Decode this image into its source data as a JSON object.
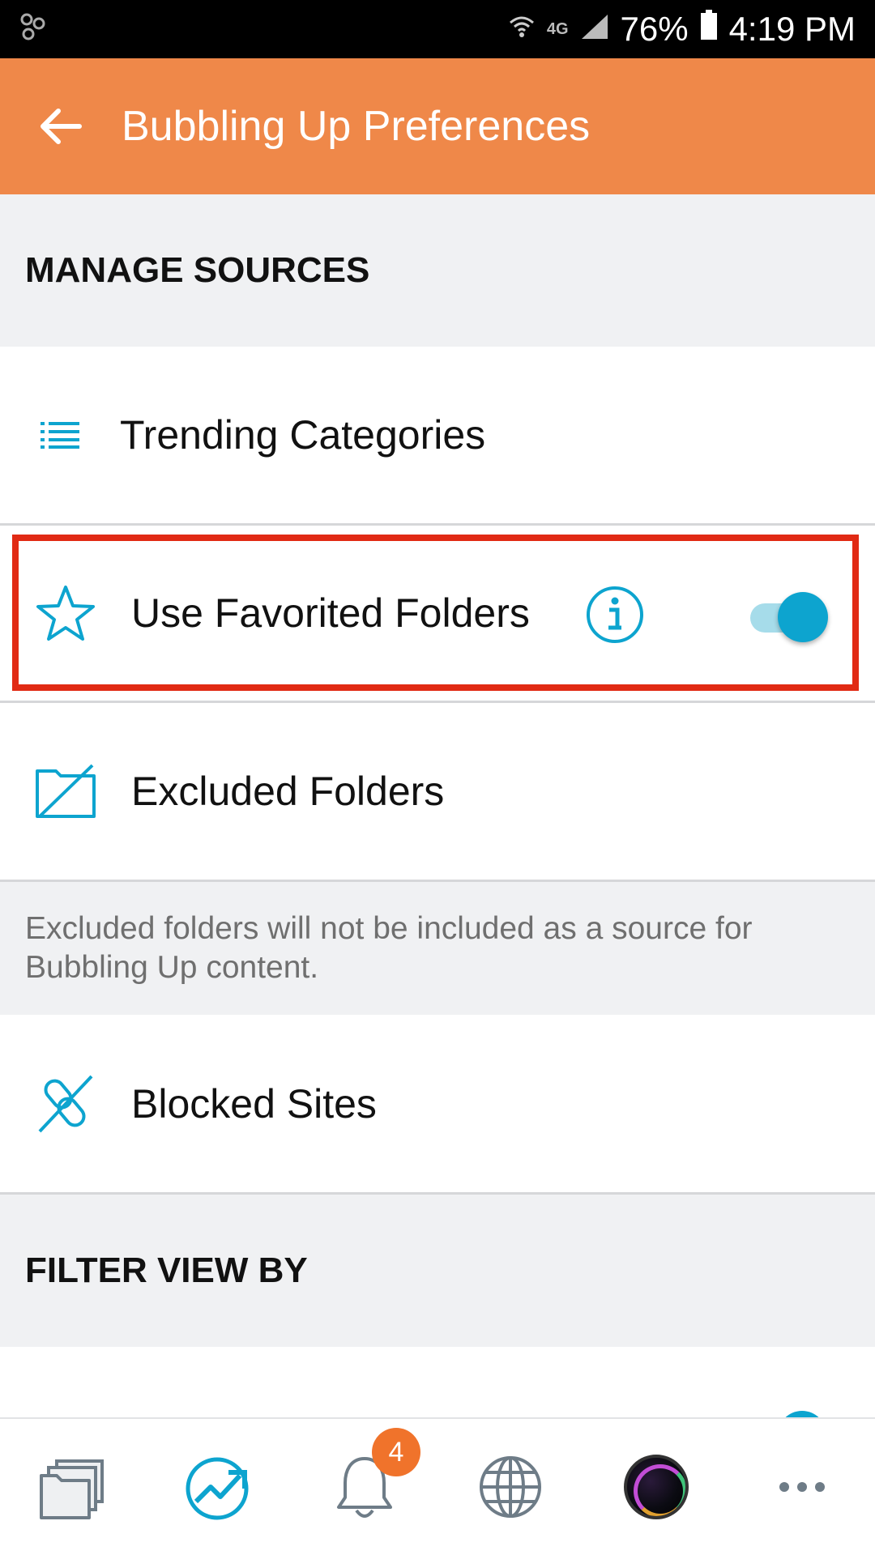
{
  "status_bar": {
    "network": "4G",
    "battery": "76%",
    "time": "4:19 PM"
  },
  "app_bar": {
    "title": "Bubbling Up Preferences"
  },
  "sections": {
    "manage_sources": "MANAGE SOURCES",
    "filter_view_by": "FILTER VIEW BY"
  },
  "rows": {
    "trending_categories": "Trending Categories",
    "use_favorited_folders": "Use Favorited Folders",
    "excluded_folders": "Excluded Folders",
    "blocked_sites": "Blocked Sites"
  },
  "favorited_folders_toggle": {
    "on": true
  },
  "excluded_note": "Excluded folders will not be included as a source for Bubbling Up content.",
  "bottom_nav": {
    "notifications_badge": "4",
    "items": [
      "folders-icon",
      "trending-icon",
      "bell-icon",
      "globe-icon",
      "avatar",
      "more-icon"
    ]
  },
  "colors": {
    "app_bar": "#ef8849",
    "accent": "#0da4cf",
    "highlight": "#e12a14",
    "badge": "#f0732b"
  }
}
